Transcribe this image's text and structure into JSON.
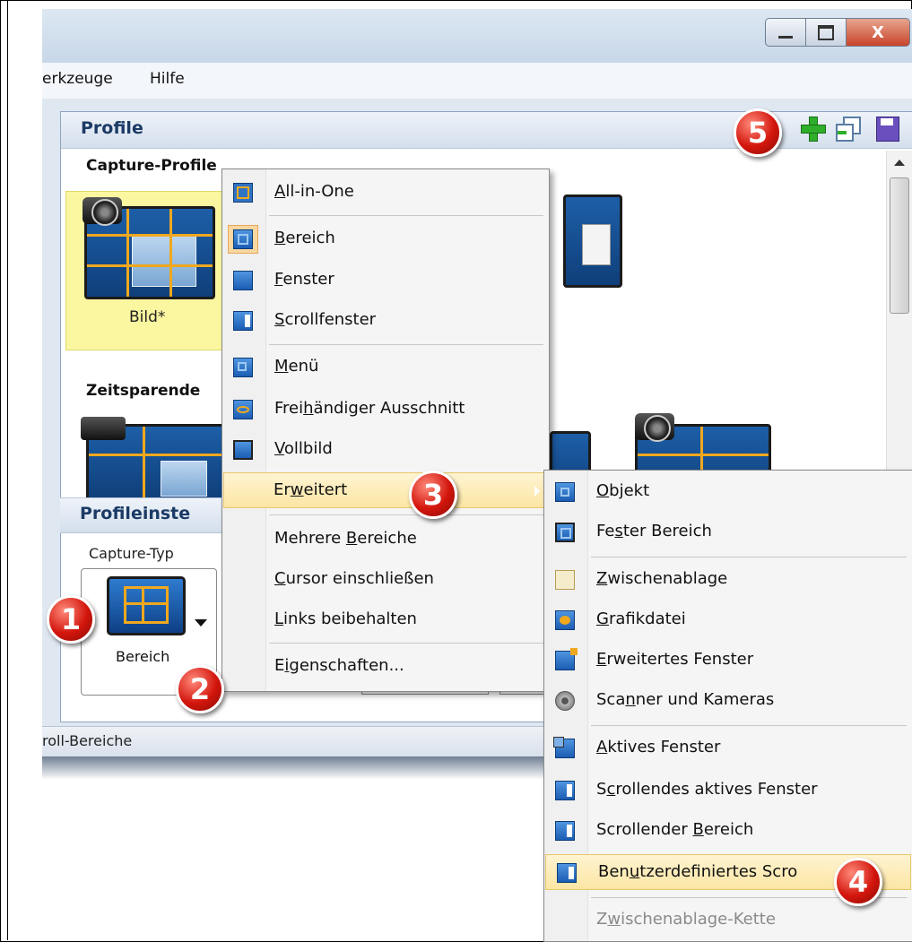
{
  "window": {
    "buttons": {
      "minimize": "–",
      "maximize": "□",
      "close": "X"
    },
    "menu": [
      "erkzeuge",
      "Hilfe"
    ]
  },
  "profile": {
    "title": "Profile",
    "capture_profiles_label": "Capture-Profile",
    "time_saving_label": "Zeitsparende",
    "selected_profile_label": "Bild*",
    "toolbar_icons": [
      "add-profile-icon",
      "copy-profile-icon",
      "save-profile-icon"
    ]
  },
  "profile_settings": {
    "title": "Profileinste",
    "capture_type_label": "Capture-Typ",
    "capture_type_value": "Bereich"
  },
  "status_bar": {
    "text": "roll-Bereiche"
  },
  "context_menu": {
    "items": [
      {
        "pre": "",
        "u": "A",
        "post": "ll-in-One",
        "icon": "all-in-one-icon"
      },
      {
        "pre": "",
        "u": "B",
        "post": "ereich",
        "icon": "region-icon"
      },
      {
        "pre": "",
        "u": "F",
        "post": "enster",
        "icon": "window-icon"
      },
      {
        "pre": "",
        "u": "S",
        "post": "crollfenster",
        "icon": "scrolling-window-icon"
      },
      {
        "pre": "",
        "u": "M",
        "post": "enü",
        "icon": "menu-icon"
      },
      {
        "pre": "Frei",
        "u": "h",
        "post": "ändiger Ausschnitt",
        "icon": "freehand-icon"
      },
      {
        "pre": "",
        "u": "V",
        "post": "ollbild",
        "icon": "fullscreen-icon"
      },
      {
        "pre": "Er",
        "u": "w",
        "post": "eitert",
        "icon": ""
      },
      {
        "pre": "Mehrere ",
        "u": "B",
        "post": "ereiche",
        "icon": ""
      },
      {
        "pre": "",
        "u": "C",
        "post": "ursor einschließen",
        "icon": ""
      },
      {
        "pre": "",
        "u": "L",
        "post": "inks beibehalten",
        "icon": ""
      },
      {
        "pre": "E",
        "u": "i",
        "post": "genschaften...",
        "icon": ""
      }
    ]
  },
  "submenu": {
    "items": [
      {
        "pre": "",
        "u": "O",
        "post": "bjekt",
        "icon": "object-icon"
      },
      {
        "pre": "Fe",
        "u": "s",
        "post": "ter Bereich",
        "icon": "fixed-region-icon"
      },
      {
        "pre": "",
        "u": "Z",
        "post": "wischenablage",
        "icon": "clipboard-icon"
      },
      {
        "pre": "",
        "u": "G",
        "post": "rafikdatei",
        "icon": "image-file-icon"
      },
      {
        "pre": "",
        "u": "E",
        "post": "rweitertes Fenster",
        "icon": "extended-window-icon"
      },
      {
        "pre": "Sca",
        "u": "n",
        "post": "ner und Kameras",
        "icon": "webcam-icon"
      },
      {
        "pre": "",
        "u": "A",
        "post": "ktives Fenster",
        "icon": "active-window-icon"
      },
      {
        "pre": "S",
        "u": "c",
        "post": "rollendes aktives Fenster",
        "icon": "scrolling-active-window-icon"
      },
      {
        "pre": "Scrollender ",
        "u": "B",
        "post": "ereich",
        "icon": "scrolling-region-icon"
      },
      {
        "pre": "Ben",
        "u": "u",
        "post": "tzerdefiniertes Scro",
        "icon": "custom-scroll-icon"
      },
      {
        "pre": "Z",
        "u": "w",
        "post": "ischenablage-Kette",
        "icon": ""
      }
    ]
  },
  "callouts": [
    "1",
    "2",
    "3",
    "4",
    "5"
  ]
}
